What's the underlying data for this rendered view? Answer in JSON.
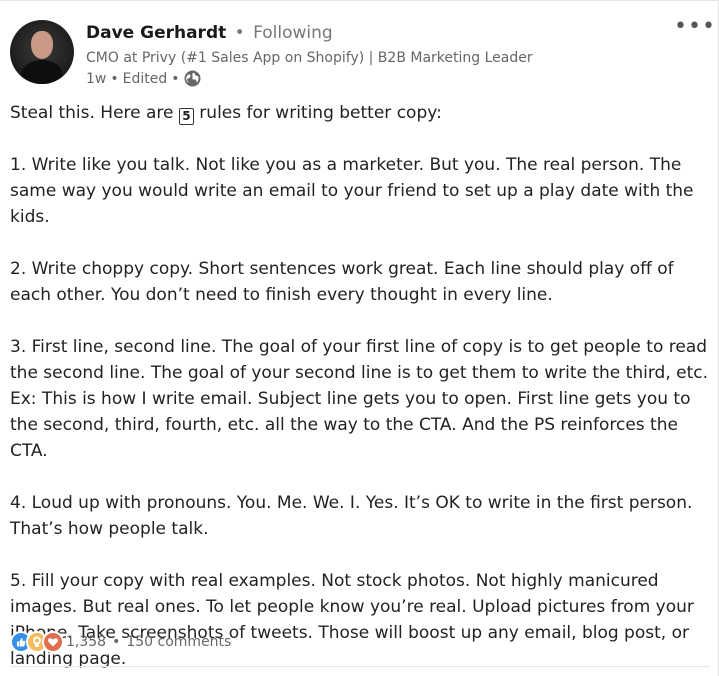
{
  "author": {
    "name": "Dave Gerhardt",
    "separator": "•",
    "follow_status": "Following",
    "headline": "CMO at Privy (#1 Sales App on Shopify) | B2B Marketing Leader",
    "time": "1w",
    "edited": "Edited"
  },
  "post": {
    "intro_before": "Steal this. Here are ",
    "intro_number": "5",
    "intro_after": " rules for writing better copy:",
    "rule1": "1. Write like you talk. Not like you as a marketer. But you. The real person. The same way you would write an email to your friend to set up a play date with the kids.",
    "rule2": "2. Write choppy copy. Short sentences work great. Each line should play off of each other. You don’t need to finish every thought in every line.",
    "rule3": "3. First line, second line. The goal of your first line of copy is to get people to read the second line. The goal of your second line is to get them to write the third, etc. Ex: This is how I write email. Subject line gets you to open. First line gets you to the second, third, fourth, etc. all the way to the CTA. And the PS reinforces the CTA.",
    "rule4": "4. Loud up with pronouns. You. Me. We. I. Yes. It’s OK to write in the first person. That’s how people talk.",
    "rule5": "5. Fill your copy with real examples. Not stock photos. Not highly manicured images. But real ones. To let people know you’re real. Upload pictures from your iPhone. Take screenshots of tweets. Those will boost up any email, blog post, or landing page."
  },
  "social": {
    "reactions": [
      "like-icon",
      "insightful-icon",
      "love-icon"
    ],
    "reaction_count": "1,358",
    "separator": "•",
    "comments": "150 comments"
  },
  "colors": {
    "like": "#378fe9",
    "insightful": "#f5bb5c",
    "love": "#df704d"
  }
}
